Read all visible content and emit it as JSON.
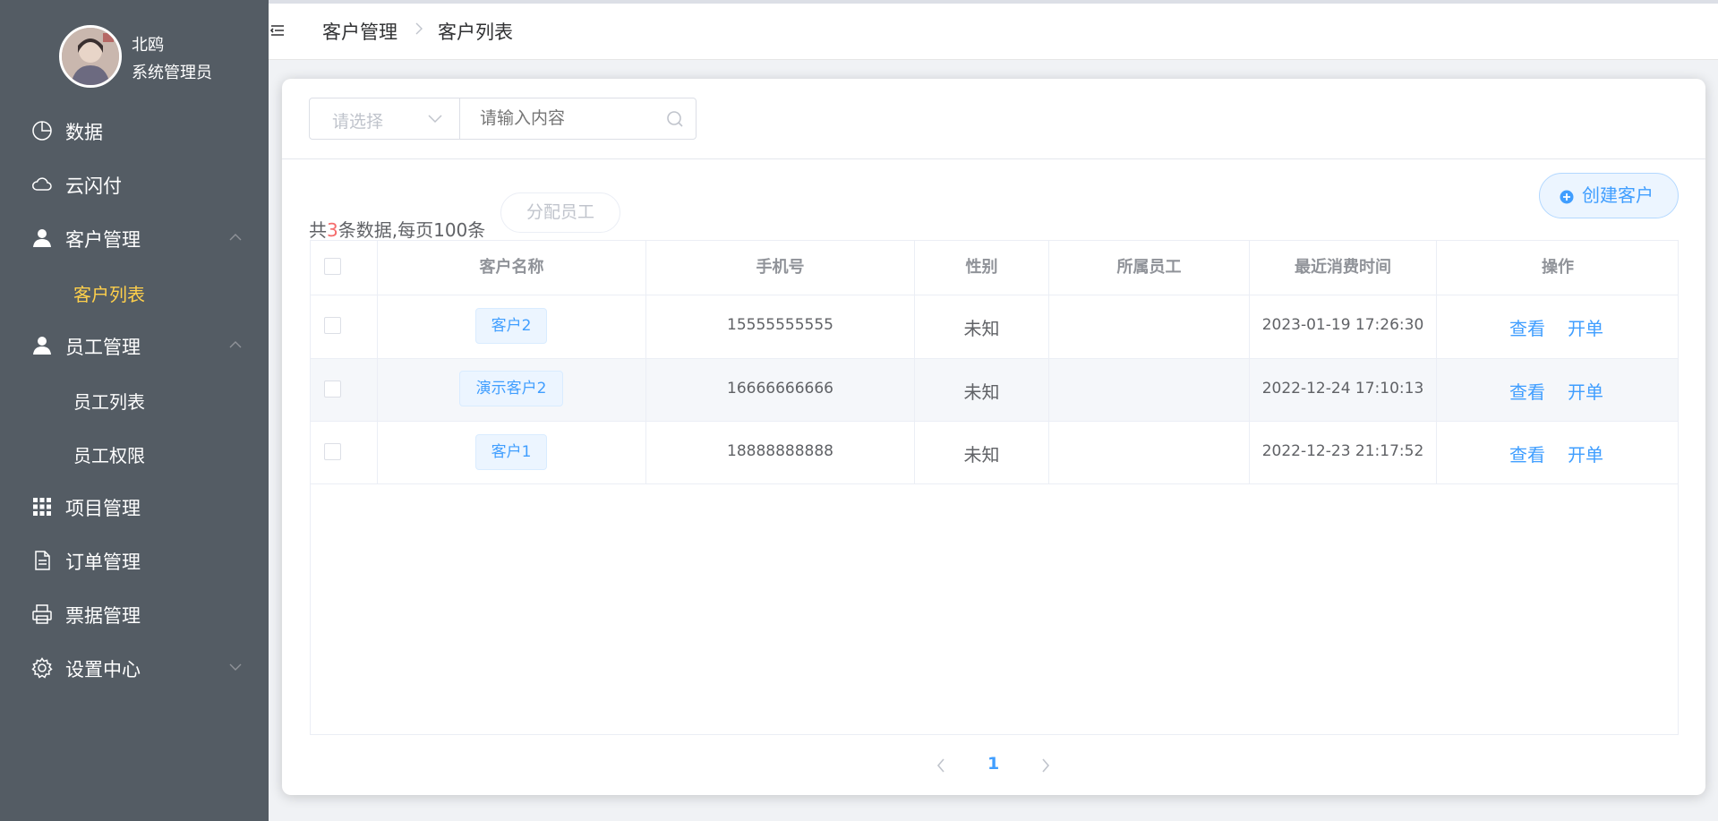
{
  "user": {
    "name": "北鸥",
    "role": "系统管理员"
  },
  "sidebar": {
    "items": [
      {
        "label": "数据",
        "icon": "pie-chart-icon"
      },
      {
        "label": "云闪付",
        "icon": "cloud-icon"
      },
      {
        "label": "客户管理",
        "icon": "user-icon",
        "expanded": true
      },
      {
        "label": "客户列表",
        "sub": true,
        "active": true
      },
      {
        "label": "员工管理",
        "icon": "user-icon",
        "expanded": true
      },
      {
        "label": "员工列表",
        "sub": true
      },
      {
        "label": "员工权限",
        "sub": true
      },
      {
        "label": "项目管理",
        "icon": "grid-icon"
      },
      {
        "label": "订单管理",
        "icon": "document-icon"
      },
      {
        "label": "票据管理",
        "icon": "printer-icon"
      },
      {
        "label": "设置中心",
        "icon": "gear-icon",
        "expanded": false
      }
    ],
    "active_color": "#ffd04b",
    "bg_color": "#545c64"
  },
  "breadcrumb": {
    "parent": "客户管理",
    "current": "客户列表"
  },
  "search": {
    "select_placeholder": "请选择",
    "input_placeholder": "请输入内容"
  },
  "toolbar": {
    "create_label": "创建客户",
    "assign_label": "分配员工"
  },
  "summary": {
    "prefix": "共",
    "count": "3",
    "suffix": "条数据,每页100条"
  },
  "table": {
    "headers": [
      "客户名称",
      "手机号",
      "性别",
      "所属员工",
      "最近消费时间",
      "操作"
    ],
    "rows": [
      {
        "name": "客户2",
        "phone": "15555555555",
        "gender": "未知",
        "staff": "",
        "last_time": "2023-01-19 17:26:30",
        "view": "查看",
        "order": "开单"
      },
      {
        "name": "演示客户2",
        "phone": "16666666666",
        "gender": "未知",
        "staff": "",
        "last_time": "2022-12-24 17:10:13",
        "view": "查看",
        "order": "开单"
      },
      {
        "name": "客户1",
        "phone": "18888888888",
        "gender": "未知",
        "staff": "",
        "last_time": "2022-12-23 21:17:52",
        "view": "查看",
        "order": "开单"
      }
    ]
  },
  "pagination": {
    "current_page": "1"
  },
  "colors": {
    "primary": "#409eff",
    "count_highlight": "#f56c6c"
  }
}
